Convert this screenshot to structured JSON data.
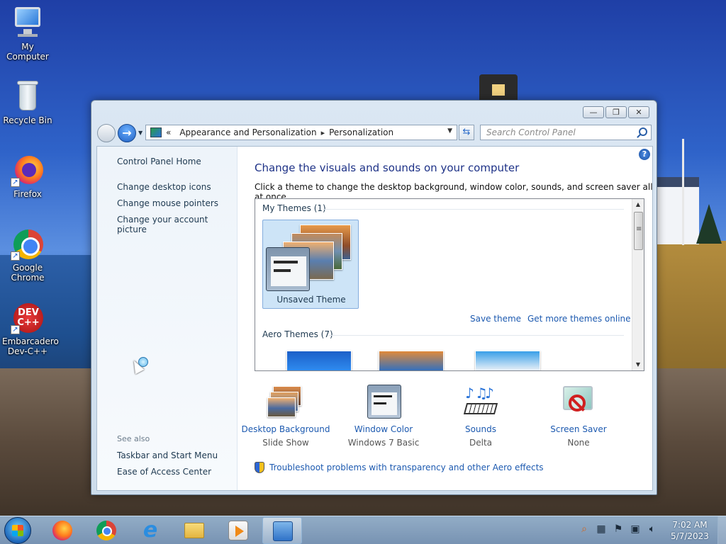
{
  "desktop": {
    "icons": [
      {
        "label": "My Computer"
      },
      {
        "label": "Recycle Bin"
      },
      {
        "label": "Firefox"
      },
      {
        "label": "Google Chrome"
      },
      {
        "label": "Embarcadero Dev-C++",
        "badge": "DEV C++"
      }
    ]
  },
  "window": {
    "controls": {
      "minimize": "—",
      "maximize": "❐",
      "close": "✕"
    },
    "address": {
      "prefix": "«",
      "crumbs": [
        "Appearance and Personalization",
        "Personalization"
      ],
      "separator": "▸"
    },
    "search": {
      "placeholder": "Search Control Panel"
    },
    "help": "?",
    "sidebar": {
      "home": "Control Panel Home",
      "links": [
        "Change desktop icons",
        "Change mouse pointers",
        "Change your account picture"
      ],
      "see_also_title": "See also",
      "see_also": [
        "Taskbar and Start Menu",
        "Ease of Access Center"
      ]
    },
    "main": {
      "title": "Change the visuals and sounds on your computer",
      "description": "Click a theme to change the desktop background, window color, sounds, and screen saver all at once.",
      "my_themes_title": "My Themes (1)",
      "selected_theme": "Unsaved Theme",
      "save_theme": "Save theme",
      "get_more": "Get more themes online",
      "aero_themes_title": "Aero Themes (7)",
      "bottom": [
        {
          "name": "Desktop Background",
          "value": "Slide Show"
        },
        {
          "name": "Window Color",
          "value": "Windows 7 Basic"
        },
        {
          "name": "Sounds",
          "value": "Delta"
        },
        {
          "name": "Screen Saver",
          "value": "None"
        }
      ],
      "troubleshoot": "Troubleshoot problems with transparency and other Aero effects"
    }
  },
  "taskbar": {
    "clock": {
      "time": "7:02 AM",
      "date": "5/7/2023"
    }
  },
  "colors": {
    "link": "#1d5ab0",
    "title": "#1e3287",
    "selection": "#cde4f7"
  }
}
